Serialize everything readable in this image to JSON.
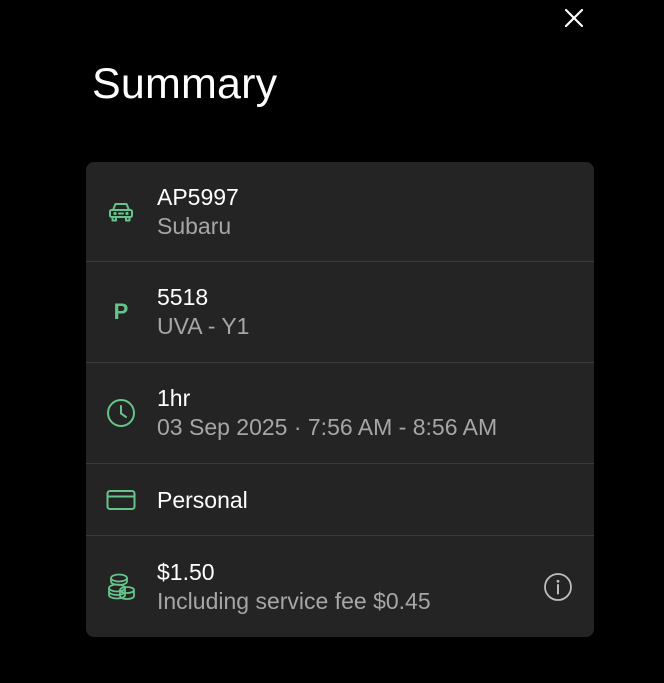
{
  "header": {
    "title": "Summary"
  },
  "colors": {
    "background": "#000000",
    "card": "#242424",
    "accent": "#66c48a",
    "secondary_text": "#a6a6a6"
  },
  "summary": {
    "vehicle": {
      "icon": "car-icon",
      "plate": "AP5997",
      "make": "Subaru"
    },
    "zone": {
      "icon": "parking-icon",
      "icon_glyph": "P",
      "code": "5518",
      "name": "UVA - Y1"
    },
    "duration": {
      "icon": "clock-icon",
      "length": "1hr",
      "period": "03 Sep 2025 · 7:56 AM - 8:56 AM"
    },
    "payment": {
      "icon": "credit-card-icon",
      "method": "Personal"
    },
    "price": {
      "icon": "coins-icon",
      "total": "$1.50",
      "note": "Including service fee $0.45",
      "info_icon": "info-icon"
    }
  }
}
